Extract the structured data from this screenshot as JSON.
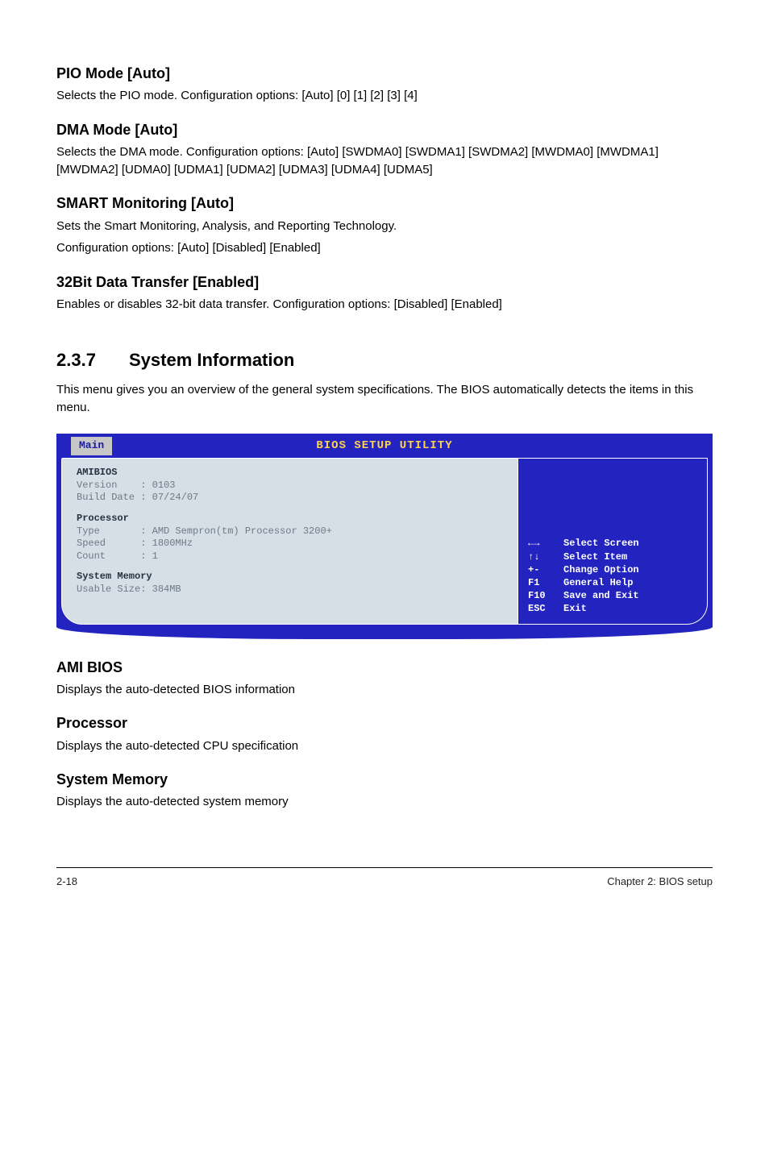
{
  "sections": {
    "pio": {
      "heading": "PIO Mode [Auto]",
      "body": "Selects the PIO mode. Configuration options: [Auto] [0] [1] [2] [3] [4]"
    },
    "dma": {
      "heading": "DMA Mode [Auto]",
      "body": "Selects the DMA mode. Configuration options: [Auto] [SWDMA0] [SWDMA1] [SWDMA2] [MWDMA0] [MWDMA1] [MWDMA2] [UDMA0] [UDMA1] [UDMA2] [UDMA3] [UDMA4] [UDMA5]"
    },
    "smart": {
      "heading": "SMART Monitoring [Auto]",
      "body1": "Sets the Smart Monitoring, Analysis, and Reporting Technology.",
      "body2": "Configuration options: [Auto] [Disabled] [Enabled]"
    },
    "bit32": {
      "heading": "32Bit Data Transfer [Enabled]",
      "body": "Enables or disables 32-bit data transfer. Configuration options: [Disabled] [Enabled]"
    },
    "sysinfo": {
      "num": "2.3.7",
      "title": "System Information",
      "intro": "This menu gives you an overview of the general system specifications. The BIOS automatically detects the items in this menu."
    },
    "ami": {
      "heading": "AMI BIOS",
      "body": "Displays the auto-detected BIOS information"
    },
    "proc": {
      "heading": "Processor",
      "body": "Displays the auto-detected CPU specification"
    },
    "sysmem": {
      "heading": "System Memory",
      "body": "Displays the auto-detected system memory"
    }
  },
  "bios": {
    "title": "BIOS SETUP UTILITY",
    "tab": "Main",
    "left": {
      "amibios_label": "AMIBIOS",
      "version_line": "Version    : 0103",
      "build_line": "Build Date : 07/24/07",
      "proc_label": "Processor",
      "type_line": "Type       : AMD Sempron(tm) Processor 3200+",
      "speed_line": "Speed      : 1800MHz",
      "count_line": "Count      : 1",
      "sysmem_label": "System Memory",
      "usable_line": "Usable Size: 384MB"
    },
    "legend": [
      {
        "key": "←→",
        "text": "Select Screen"
      },
      {
        "key": "↑↓",
        "text": "Select Item"
      },
      {
        "key": "+-",
        "text": "Change Option"
      },
      {
        "key": "F1",
        "text": "General Help"
      },
      {
        "key": "F10",
        "text": "Save and Exit"
      },
      {
        "key": "ESC",
        "text": "Exit"
      }
    ]
  },
  "footer": {
    "left": "2-18",
    "right": "Chapter 2: BIOS setup"
  }
}
